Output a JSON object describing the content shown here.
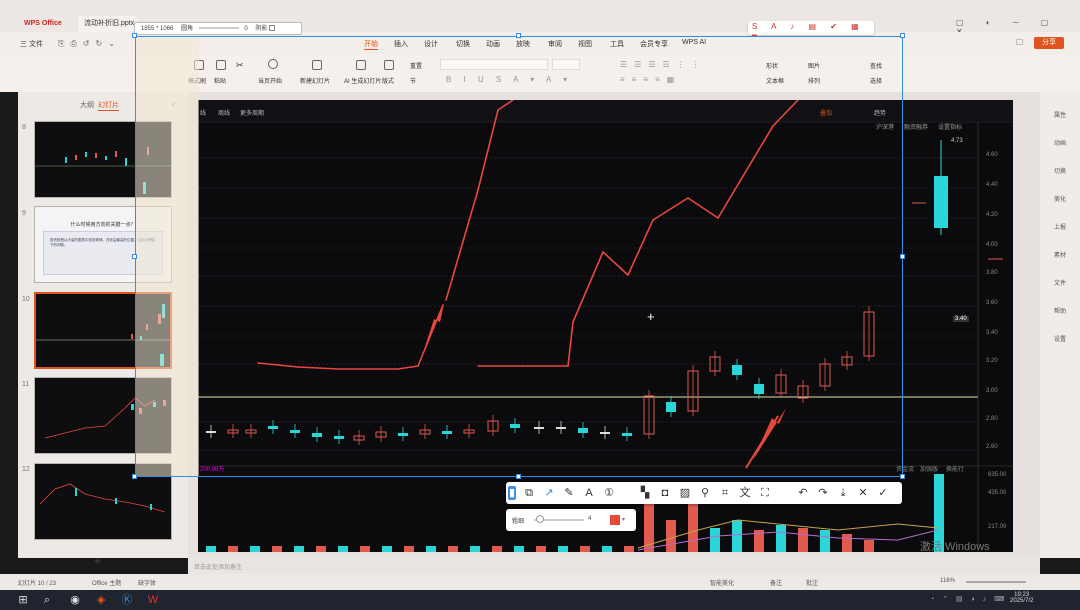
{
  "app": {
    "title": "WPS Office",
    "doc_tab": "流动补折旧.pptx"
  },
  "menu": {
    "file": "三 文件",
    "items": [
      "开始",
      "插入",
      "设计",
      "切换",
      "动画",
      "放映",
      "审阅",
      "视图",
      "工具",
      "会员专享",
      "WPS AI"
    ],
    "active": "开始",
    "share": "分享"
  },
  "ribbon": {
    "format_painter": "格式刷",
    "paste": "粘贴",
    "from_start": "当页开始",
    "new_slide": "新建幻灯片",
    "ai_slide": "AI 生成幻灯片",
    "layout": "版式",
    "reset": "重置",
    "section": "节",
    "shape": "形状",
    "image": "图片",
    "textbox": "文本框",
    "arrange": "排列",
    "find": "查找",
    "select": "选择"
  },
  "left_pane": {
    "tab_outline": "大纲",
    "tab_slides": "幻灯片",
    "thumb_numbers": [
      "8",
      "9",
      "10",
      "11",
      "12"
    ],
    "thumb9_title": "什么时候用方向的关键一点？",
    "thumb9_body": "投资就是从大量的图表中找到规律，在收益最高的位置，引出对理性下的判断。",
    "add": "+"
  },
  "capture": {
    "size_label": "1855 * 1066",
    "opacity_label": "圆角",
    "opacity_value": "0",
    "shadow_label": "阴影"
  },
  "chart": {
    "top_tabs": [
      "线",
      "周线",
      "更多周期"
    ],
    "overlay_label": "叠加",
    "trend_label": "趋势",
    "price_labels": [
      "4.60",
      "4.40",
      "4.20",
      "4.00",
      "3.80",
      "3.60",
      "3.40",
      "3.20",
      "3.00",
      "2.80",
      "2.60"
    ],
    "current_price": "3.40",
    "top_high": "4.73",
    "vol_label": "200.98万",
    "vol_scale": [
      "635.00",
      "435.00",
      "217.00",
      "万"
    ],
    "side_tabs": [
      "沪深港",
      "融资融券",
      "设置指标"
    ],
    "bottom_tabs": [
      "资金流",
      "加强版",
      "换能行"
    ]
  },
  "annotation_bar": {
    "icons": [
      "rect-icon",
      "ellipse-icon",
      "arrow-icon",
      "pen-icon",
      "text-icon",
      "number-icon",
      "mosaic-icon",
      "blur-icon",
      "hatch-icon",
      "pin-icon",
      "ocr-icon",
      "translate-icon",
      "scan-icon",
      "undo-icon",
      "redo-icon",
      "download-icon",
      "close-icon",
      "confirm-icon"
    ],
    "size_label": "粗细",
    "size_value": "4"
  },
  "statusbar": {
    "slide_count": "幻灯片 10 / 23",
    "theme": "Office 主题",
    "font_missing": "缺字体",
    "notes": "单击此处添加备注",
    "smart_beauty": "智能美化",
    "notes_btn": "备注",
    "comments": "批注",
    "zoom": "116%"
  },
  "activate_windows": "激活 Windows",
  "taskbar": {
    "time": "19:23",
    "date": "2025/7/2"
  },
  "colors": {
    "accent": "#e0531c",
    "candle_up": "#e05a4e",
    "candle_down": "#2ad6d8",
    "arrow": "#e8473d",
    "selection": "#3a8de0",
    "bg_dark": "#0b0b0d"
  }
}
